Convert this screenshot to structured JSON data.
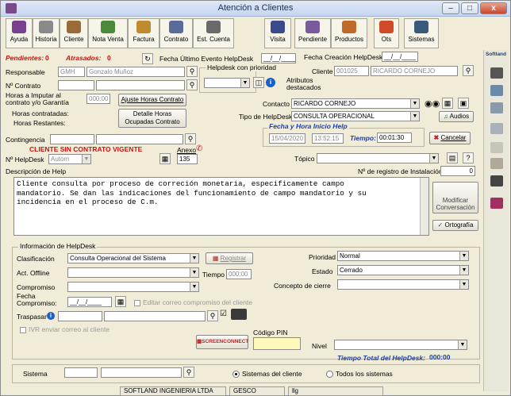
{
  "window": {
    "title": "Atención a Clientes"
  },
  "toolbar": [
    {
      "label": "Ayuda",
      "icon": "help-book-icon",
      "color": "#7a3f8f"
    },
    {
      "label": "Historia",
      "icon": "history-icon",
      "color": "#8a8a8a"
    },
    {
      "label": "Cliente",
      "icon": "client-icon",
      "color": "#9a6a3a"
    },
    {
      "label": "Nota Venta",
      "icon": "sales-note-icon",
      "color": "#4a8a3a"
    },
    {
      "label": "Factura",
      "icon": "invoice-icon",
      "color": "#c08a30"
    },
    {
      "label": "Contrato",
      "icon": "contract-icon",
      "color": "#5a6a9a"
    },
    {
      "label": "Est. Cuenta",
      "icon": "account-statement-icon",
      "color": "#6a6a6a"
    },
    {
      "label": "Visita",
      "icon": "visit-icon",
      "color": "#3a4a8a"
    },
    {
      "label": "Pendiente",
      "icon": "pending-icon",
      "color": "#7a5a9a"
    },
    {
      "label": "Productos",
      "icon": "products-icon",
      "color": "#c06a2a"
    },
    {
      "label": "Ots",
      "icon": "work-orders-icon",
      "color": "#d04a2a"
    },
    {
      "label": "Sistemas",
      "icon": "systems-icon",
      "color": "#3a5a7a"
    }
  ],
  "header": {
    "pendientes_label": "Pendientes:",
    "pendientes": "0",
    "atrasados_label": "Atrasados:",
    "atrasados": "0",
    "fecha_ultimo_label": "Fecha Último Evento HelpDesk",
    "fecha_ultimo": "__/__/____",
    "fecha_creacion_label": "Fecha Creación HelpDesk",
    "fecha_creacion": "__/__/____"
  },
  "form": {
    "responsable_label": "Responsable",
    "responsable_code": "GMH",
    "responsable_name": "Gonzalo Muñoz",
    "helpdesk_prioridad_label": "Helpdesk con prioridad",
    "cliente_label": "Cliente",
    "cliente_code": "001025",
    "cliente_name": "RICARDO CORNEJO",
    "atributos_label": "Atributos destacados",
    "contrato_label": "Nº Contrato",
    "horas_imputar_label": "Horas a Imputar al contrato y/o Garantía",
    "horas_imputar": "000:00",
    "ajuste_btn": "Ajuste Horas Contrato",
    "horas_contratadas_label": "Horas contratadas:",
    "horas_restantes_label": "Horas Restantes:",
    "detalle_btn": "Detalle Horas Ocupadas Contrato",
    "contacto_label": "Contacto",
    "contacto": "RICARDO CORNEJO",
    "tipo_label": "Tipo de HelpDesk",
    "tipo": "CONSULTA OPERACIONAL",
    "audios_btn": "Audios",
    "fecha_inicio_label": "Fecha y Hora Inicio Help",
    "fecha_inicio": "15/04/2020",
    "hora_inicio": "13:52:15",
    "tiempo_label": "Tiempo:",
    "tiempo": "00:01:30",
    "cancelar_btn": "Cancelar",
    "contingencia_label": "Contingencia",
    "sin_contrato": "CLIENTE SIN CONTRATO VIGENTE",
    "nhelpdesk_label": "Nº HelpDesk",
    "nhelpdesk": "Autom",
    "anexo_label": "Anexo",
    "anexo": "135",
    "topico_label": "Tópico",
    "descripcion_label": "Descripción de Help",
    "registro_label": "Nº de registro de Instalación",
    "registro": "0",
    "descripcion": "Cliente consulta por proceso de correción monetaria, especificamente campo\nmandatorio. Se dan las indicaciones del funcionamiento de campo mandatorio y su\nincidencia en el proceso de C.m.",
    "modificar_btn": "Modificar Conversación",
    "ortografia_btn": "Ortografía"
  },
  "info": {
    "legend": "Información de HelpDesk",
    "clasificacion_label": "Clasificación",
    "clasificacion": "Consulta Operacional del Sistema",
    "registrar_btn": "Registrar",
    "prioridad_label": "Prioridad",
    "prioridad": "Normal",
    "act_offline_label": "Act. Offline",
    "tiempo_label": "Tiempo",
    "tiempo": "000:00",
    "estado_label": "Estado",
    "estado": "Cerrado",
    "compromiso_label": "Compromiso",
    "concepto_label": "Concepto de cierre",
    "fecha_compromiso_label": "Fecha Compromiso:",
    "fecha_compromiso": "__/__/____",
    "editar_correo_label": "Editar correo compromiso del cliente",
    "traspasar_label": "Traspasar a:",
    "ivr_label": "IVR enviar correo al cliente",
    "screenconnect": "SCREENCONNECT",
    "codigo_pin_label": "Código PIN",
    "nivel_label": "Nivel",
    "tiempo_total_label": "Tiempo Total del HelpDesk:",
    "tiempo_total": "000:00"
  },
  "sistema": {
    "label": "Sistema",
    "opt1": "Sistemas del cliente",
    "opt2": "Todos los sistemas"
  },
  "status": {
    "s1": "SOFTLAND INGENIERIA LTDA",
    "s2": "GESCO",
    "s3": "llg"
  },
  "side": {
    "label": "Softland"
  }
}
